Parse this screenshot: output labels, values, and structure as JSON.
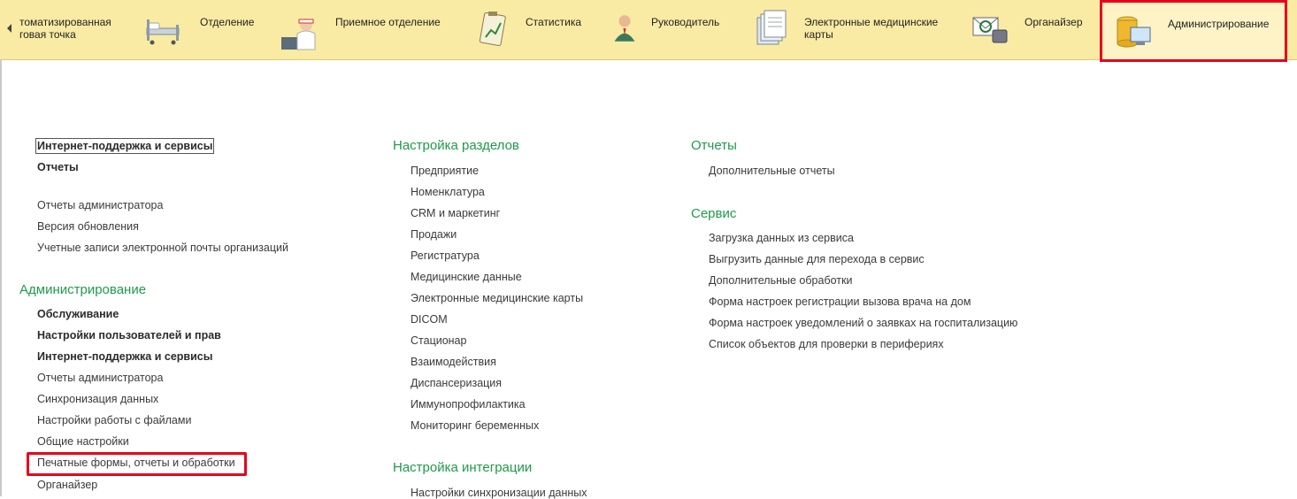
{
  "sections": [
    {
      "label": "томатизированная\nговая точка",
      "icon": "cash-register-icon"
    },
    {
      "label": "Отделение",
      "icon": "hospital-bed-icon"
    },
    {
      "label": "Приемное отделение",
      "icon": "nurse-icon"
    },
    {
      "label": "Статистика",
      "icon": "clipboard-chart-icon"
    },
    {
      "label": "Руководитель",
      "icon": "manager-icon"
    },
    {
      "label": "Электронные медицинские карты",
      "icon": "documents-icon"
    },
    {
      "label": "Органайзер",
      "icon": "email-phone-icon"
    },
    {
      "label": "Администрирование",
      "icon": "database-computer-icon"
    }
  ],
  "left_column": {
    "top_items": [
      {
        "label": "Интернет-поддержка и сервисы",
        "bold": true
      },
      {
        "label": "Отчеты",
        "bold": true
      },
      {
        "label": "Отчеты администратора",
        "bold": false
      },
      {
        "label": "Версия обновления",
        "bold": false
      },
      {
        "label": "Учетные записи электронной почты организаций",
        "bold": false
      }
    ],
    "admin_heading": "Администрирование",
    "admin_items": [
      {
        "label": "Обслуживание",
        "bold": true
      },
      {
        "label": "Настройки пользователей и прав",
        "bold": true
      },
      {
        "label": "Интернет-поддержка и сервисы",
        "bold": true
      },
      {
        "label": "Отчеты администратора",
        "bold": false
      },
      {
        "label": "Синхронизация данных",
        "bold": false
      },
      {
        "label": "Настройки работы с файлами",
        "bold": false
      },
      {
        "label": "Общие настройки",
        "bold": false
      },
      {
        "label": "Печатные формы, отчеты и обработки",
        "bold": false
      },
      {
        "label": "Органайзер",
        "bold": false
      }
    ]
  },
  "middle_column": {
    "heading": "Настройка разделов",
    "items": [
      "Предприятие",
      "Номенклатура",
      "CRM и маркетинг",
      "Продажи",
      "Регистратура",
      "Медицинские данные",
      "Электронные медицинские карты",
      "DICOM",
      "Стационар",
      "Взаимодействия",
      "Диспансеризация",
      "Иммунопрофилактика",
      "Мониторинг беременных"
    ],
    "heading2": "Настройка интеграции",
    "items2": [
      "Настройки синхронизации данных"
    ]
  },
  "right_column": {
    "reports_heading": "Отчеты",
    "reports_items": [
      "Дополнительные отчеты"
    ],
    "service_heading": "Сервис",
    "service_items": [
      "Загрузка данных из сервиса",
      "Выгрузить данные для перехода в сервис",
      "Дополнительные обработки",
      "Форма настроек регистрации вызова врача на дом",
      "Форма настроек уведомлений о заявках на госпитализацию",
      "Список объектов для проверки в периферияx"
    ]
  },
  "colors": {
    "topbar": "#f9eba3",
    "heading": "#1f9a4a",
    "highlight": "#e8001c"
  }
}
